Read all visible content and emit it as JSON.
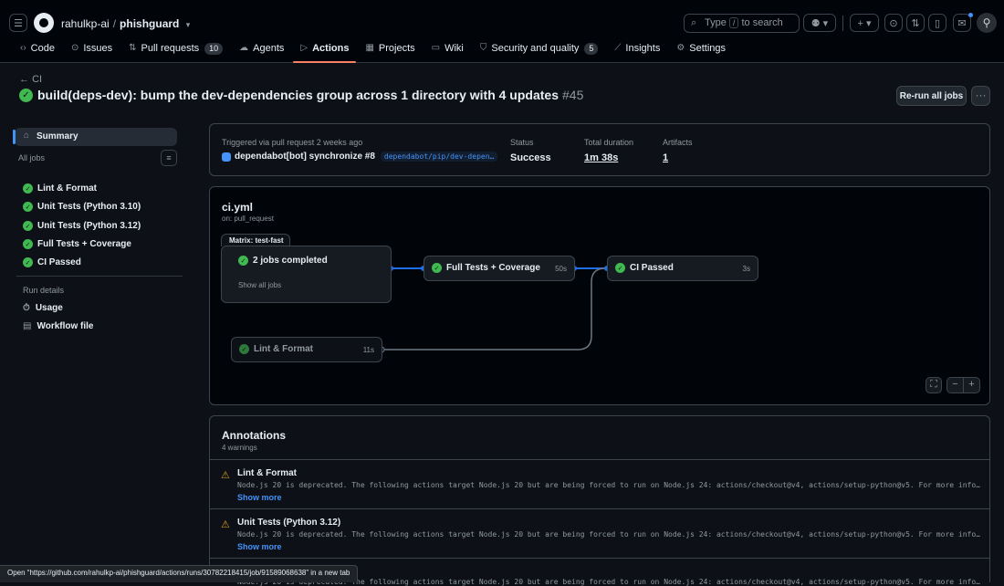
{
  "header": {
    "owner": "rahulkp-ai",
    "separator": "/",
    "repo": "phishguard",
    "search_placeholder_pre": "Type",
    "search_key": "/",
    "search_placeholder_post": "to search"
  },
  "tabs": [
    {
      "label": "Code",
      "icon": "code-icon"
    },
    {
      "label": "Issues",
      "icon": "issue-icon"
    },
    {
      "label": "Pull requests",
      "icon": "pull-request-icon",
      "count": "10"
    },
    {
      "label": "Agents",
      "icon": "agents-icon"
    },
    {
      "label": "Actions",
      "icon": "play-icon",
      "active": true
    },
    {
      "label": "Projects",
      "icon": "table-icon"
    },
    {
      "label": "Wiki",
      "icon": "book-icon"
    },
    {
      "label": "Security and quality",
      "icon": "shield-icon",
      "count": "5"
    },
    {
      "label": "Insights",
      "icon": "graph-icon"
    },
    {
      "label": "Settings",
      "icon": "gear-icon"
    }
  ],
  "run": {
    "back_label": "CI",
    "title": "build(deps-dev): bump the dev-dependencies group across 1 directory with 4 updates",
    "number": "#45",
    "rerun_label": "Re-run all jobs"
  },
  "sidebar": {
    "summary_label": "Summary",
    "all_jobs_label": "All jobs",
    "jobs": [
      "Lint & Format",
      "Unit Tests (Python 3.10)",
      "Unit Tests (Python 3.12)",
      "Full Tests + Coverage",
      "CI Passed"
    ],
    "run_details_label": "Run details",
    "links": [
      "Usage",
      "Workflow file"
    ]
  },
  "trigger": {
    "label": "Triggered via pull request 2 weeks ago",
    "actor": "dependabot[bot]",
    "action": "synchronize",
    "pr": "#8",
    "branch": "dependabot/pip/dev-depen…",
    "status_label": "Status",
    "status_value": "Success",
    "duration_label": "Total duration",
    "duration_value": "1m 38s",
    "artifacts_label": "Artifacts",
    "artifacts_value": "1"
  },
  "graph": {
    "file": "ci.yml",
    "trigger": "on: pull_request",
    "matrix_label": "Matrix: test-fast",
    "matrix_node": {
      "title": "2 jobs completed",
      "sub": "Show all jobs"
    },
    "coverage_node": {
      "title": "Full Tests + Coverage",
      "duration": "50s"
    },
    "ci_node": {
      "title": "CI Passed",
      "duration": "3s"
    },
    "lint_node": {
      "title": "Lint & Format",
      "duration": "11s"
    },
    "colors": {
      "edge_active": "#1f6feb",
      "edge_inactive": "#6e7681",
      "success": "#3fb950"
    }
  },
  "annotations": {
    "title": "Annotations",
    "count_label": "4 warnings",
    "items": [
      {
        "job": "Lint & Format",
        "message": "Node.js 20 is deprecated. The following actions target Node.js 20 but are being forced to run on Node.js 24: actions/checkout@v4, actions/setup-python@v5. For more informa…",
        "more": "Show more"
      },
      {
        "job": "Unit Tests (Python 3.12)",
        "message": "Node.js 20 is deprecated. The following actions target Node.js 20 but are being forced to run on Node.js 24: actions/checkout@v4, actions/setup-python@v5. For more informa…",
        "more": "Show more"
      },
      {
        "job": "",
        "message": "Node.js 20 is deprecated. The following actions target Node.js 20 but are being forced to run on Node.js 24: actions/checkout@v4, actions/setup-python@v5. For more informa…",
        "more": ""
      }
    ]
  },
  "statusbar": {
    "text": "Open “https://github.com/rahulkp-ai/phishguard/actions/runs/30782218415/job/91589068638” in a new tab"
  }
}
